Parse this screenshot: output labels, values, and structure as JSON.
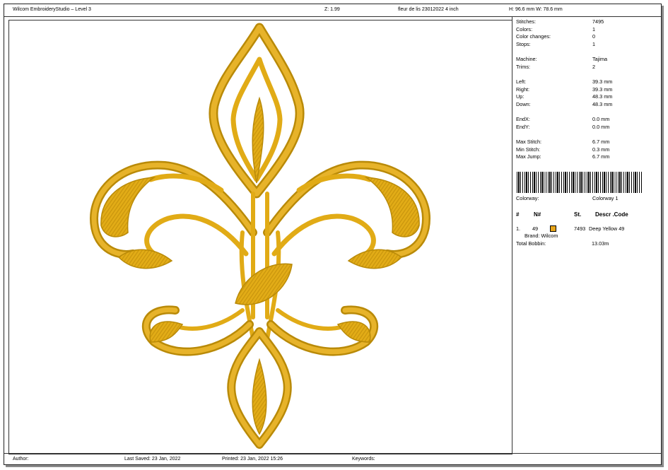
{
  "header": {
    "app_title": "Wilcom EmbroideryStudio – Level 3",
    "zoom": "Z: 1.99",
    "design_name": "fleur de lis 23012022 4 inch",
    "dimensions": "H: 96.6 mm   W: 78.6 mm"
  },
  "info": {
    "stitches_label": "Stitches:",
    "stitches": "7495",
    "colors_label": "Colors:",
    "colors": "1",
    "color_changes_label": "Color changes:",
    "color_changes": "0",
    "stops_label": "Stops:",
    "stops": "1",
    "machine_label": "Machine:",
    "machine": "Tajima",
    "trims_label": "Trims:",
    "trims": "2",
    "left_label": "Left:",
    "left": "39.3 mm",
    "right_label": "Right:",
    "right": "39.3 mm",
    "up_label": "Up:",
    "up": "48.3 mm",
    "down_label": "Down:",
    "down": "48.3 mm",
    "endx_label": "EndX:",
    "endx": "0.0 mm",
    "endy_label": "EndY:",
    "endy": "0.0 mm",
    "max_stitch_label": "Max Stitch:",
    "max_stitch": "6.7 mm",
    "min_stitch_label": "Min Stitch:",
    "min_stitch": "0.3 mm",
    "max_jump_label": "Max Jump:",
    "max_jump": "6.7 mm",
    "colorway_label": "Colorway:",
    "colorway": "Colorway 1"
  },
  "color_table": {
    "headers": {
      "num": "#",
      "n": "N#",
      "st": "St.",
      "descr": "Descr .Code"
    },
    "rows": [
      {
        "index": "1.",
        "n": "49",
        "st": "7493",
        "descr": "Deep Yellow 49",
        "brand": "Brand: Wilcom",
        "swatch": "#e8a51a"
      }
    ],
    "total_bobbin_label": "Total Bobbin:",
    "total_bobbin": "13.03m"
  },
  "footer": {
    "author": "Author:",
    "last_saved": "Last Saved: 23 Jan, 2022",
    "printed": "Printed: 23 Jan, 2022 15:26",
    "keywords": "Keywords:"
  },
  "colors": {
    "thread_gold": "#e1ab16",
    "thread_dark": "#b98a08"
  }
}
